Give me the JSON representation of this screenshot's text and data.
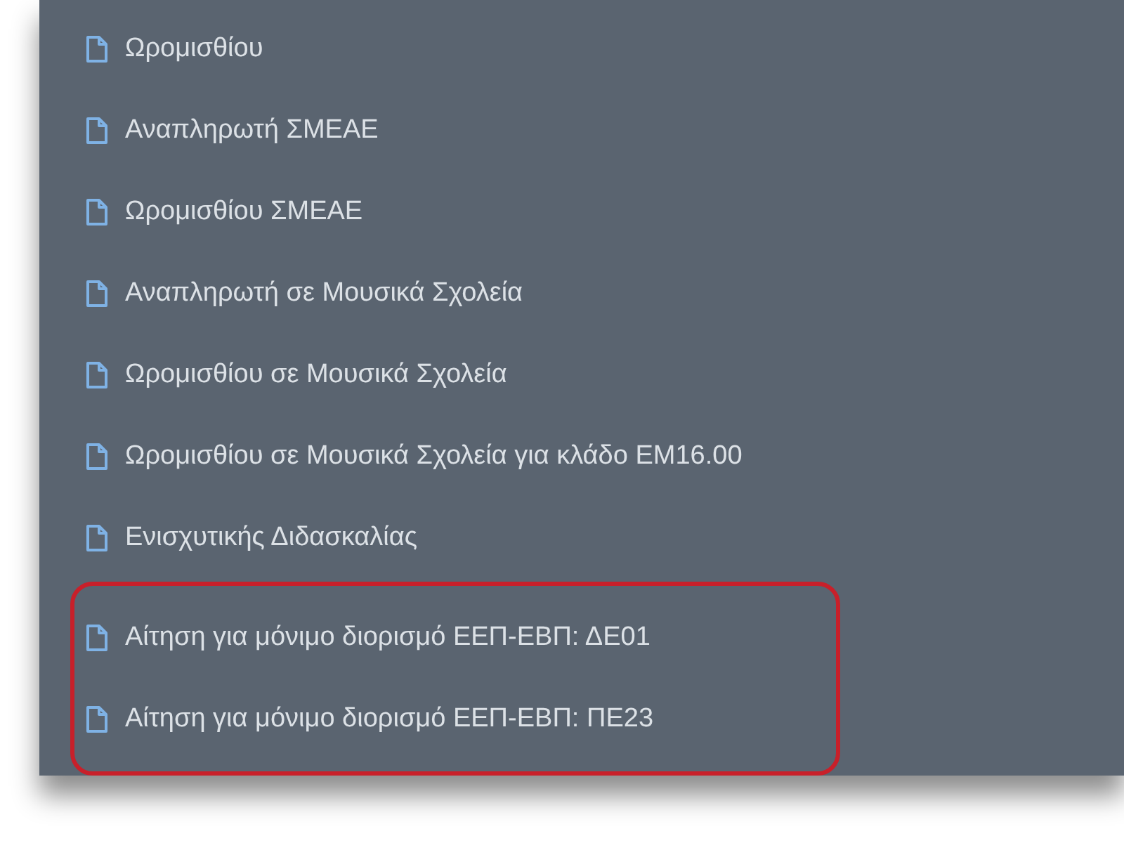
{
  "menu": {
    "items": [
      {
        "label": "Ωρομισθίου",
        "highlighted": false
      },
      {
        "label": "Αναπληρωτή ΣΜΕΑΕ",
        "highlighted": false
      },
      {
        "label": "Ωρομισθίου ΣΜΕΑΕ",
        "highlighted": false
      },
      {
        "label": "Αναπληρωτή σε Μουσικά Σχολεία",
        "highlighted": false
      },
      {
        "label": "Ωρομισθίου σε Μουσικά Σχολεία",
        "highlighted": false
      },
      {
        "label": "Ωρομισθίου σε Μουσικά Σχολεία για κλάδο ΕΜ16.00",
        "highlighted": false
      },
      {
        "label": "Ενισχυτικής Διδασκαλίας",
        "highlighted": false
      },
      {
        "label": "Αίτηση για μόνιμο διορισμό ΕΕΠ-ΕΒΠ: ΔΕ01",
        "highlighted": true
      },
      {
        "label": "Αίτηση για μόνιμο διορισμό ΕΕΠ-ΕΒΠ: ΠΕ23",
        "highlighted": true
      }
    ]
  }
}
